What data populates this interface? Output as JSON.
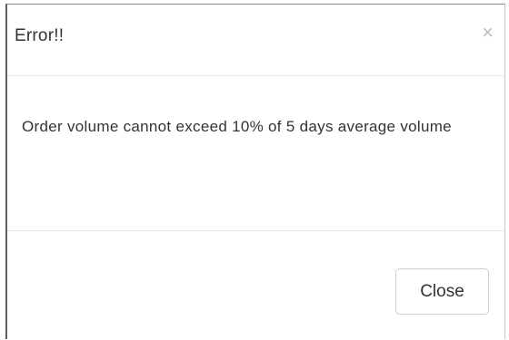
{
  "dialog": {
    "title": "Error!!",
    "close_icon": "×",
    "message": "Order volume cannot exceed 10% of 5 days average volume",
    "close_button_label": "Close"
  }
}
